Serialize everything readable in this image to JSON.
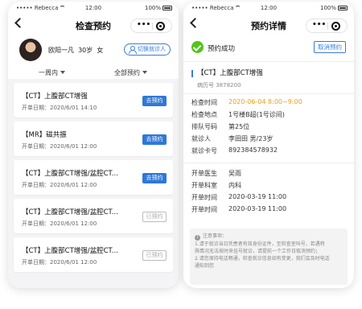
{
  "status_bar": {
    "carrier": "Rebecca",
    "time": "12:00",
    "battery": "100%"
  },
  "left_screen": {
    "title": "检查预约",
    "capsule_more": "•••",
    "patient": {
      "name": "欧阳一凡",
      "age": "30岁",
      "gender": "女"
    },
    "switch_button": "切换就诊人",
    "filters": [
      "一周内",
      "全部预约"
    ],
    "appointments": [
      {
        "title": "【CT】上腹部CT增强",
        "date": "开单日期：2020/6/01  14:10",
        "action": "去预约",
        "enabled": true
      },
      {
        "title": "【MR】磁共振",
        "date": "开单日期：2020/6/01  12:00",
        "action": "去预约",
        "enabled": true
      },
      {
        "title": "【CT】上腹部CT增强/盆腔CT...",
        "date": "开单日期：2020/6/01  12:00",
        "action": "去预约",
        "enabled": true
      },
      {
        "title": "【CT】上腹部CT增强/盆腔CT...",
        "date": "开单日期：2020/6/01  12:00",
        "action": "已预约",
        "enabled": false
      },
      {
        "title": "【CT】上腹部CT增强/盆腔CT...",
        "date": "开单日期：2020/6/01  12:00",
        "action": "已预约",
        "enabled": false
      }
    ]
  },
  "right_screen": {
    "title": "预约详情",
    "capsule_more": "•••",
    "success_text": "预约成功",
    "cancel_button": "取消预约",
    "exam_title": "【CT】上腹部CT增强",
    "record_no": "病历号 3878200",
    "schedule": [
      {
        "label": "检查时间",
        "value": "2020-06-04 8:00~9:00",
        "highlight": true
      },
      {
        "label": "检查地点",
        "value": "1号楼B超(1号诊间)",
        "highlight": false
      },
      {
        "label": "排队号码",
        "value": "第25位",
        "highlight": false
      },
      {
        "label": "就诊人",
        "value": "李田田  男/23岁",
        "highlight": false
      },
      {
        "label": "就诊卡号",
        "value": "892384578932",
        "highlight": false
      }
    ],
    "order": [
      {
        "label": "开单医生",
        "value": "吴雨"
      },
      {
        "label": "开单科室",
        "value": "内科"
      },
      {
        "label": "开单时间",
        "value": "2020-03-19 11:00"
      },
      {
        "label": "开单时间",
        "value": "2020-03-19 11:00"
      }
    ],
    "notice": {
      "title": "注意事项：",
      "lines": [
        "1.请于就诊当日凭患者有效身份证件，至检查室叫号，若遇特",
        "殊情况无法按时来挂号就诊，请提前一个工作日取消预约；",
        "2.请您保持电话畅通，检查就诊信息如有变更，我们会及时电话",
        "通知到您"
      ]
    }
  }
}
